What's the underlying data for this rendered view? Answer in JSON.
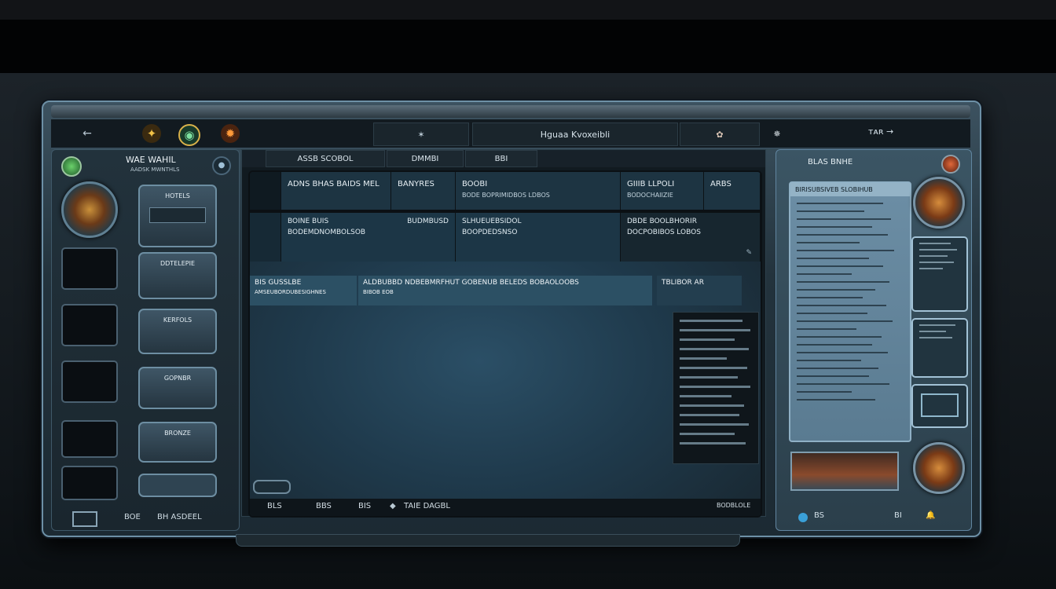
{
  "window": {
    "title": ""
  },
  "toolbar": {
    "center_label": "Hguaa Kvoxeibli",
    "right_label": "ᴛᴀʀ →",
    "right_icon_label": "🔔"
  },
  "left_panel": {
    "title": "WAE WAHIL",
    "subtitle": "AADSK MWNTHLS",
    "cards": [
      "HOTELS",
      "DDTELEPIE",
      "KERFOLS",
      "GOPNBR",
      "BRONZE"
    ],
    "footer_left": "BOE",
    "footer_right": "BH ASDEEL"
  },
  "breadcrumbs": [
    "ASSB SCOBOL",
    "DMMBI",
    "BBI"
  ],
  "columns": [
    {
      "title": "ADNS BHAS BAIDS MEL",
      "sub": ""
    },
    {
      "title": "BANYRES",
      "sub": ""
    },
    {
      "title": "BOOBI",
      "sub": "BODE  BOPRIMIDBOS LDBOS"
    },
    {
      "title": "GIIIB LLPOLI",
      "sub": "BODOCHAIIZIE"
    },
    {
      "title": "ARBS",
      "sub": ""
    }
  ],
  "rows": [
    {
      "title": "BOINE BUIS",
      "line": "BODEMDNOMBOLSOB",
      "right": "BUDMBUSD"
    },
    {
      "title": "SLHUEUEBSIDOL",
      "line": "BOOPDEDSNSO",
      "right": ""
    },
    {
      "title": "DBDE BOOLBHORIR",
      "line": "DOCPOBIBOS LOBOS",
      "right": ""
    }
  ],
  "banner": {
    "seg1": "BIS  GUSSLBE",
    "seg1_sub": "AMSEUBORDUBESIGHNES",
    "seg2": "ALDBUBBD NDBEBMRFHUT   GOBENUB  BELEDS BOBAOLOOBS",
    "seg2_sub": "BIBOB  EOB",
    "seg3": "TBLIBOR AR"
  },
  "vp_footer": {
    "a": "BLS",
    "b": "BBS",
    "c": "BIS",
    "d": "TAIE DAGBL",
    "e": "BODBLOLE"
  },
  "right_panel": {
    "title": "BLAS  BNHE",
    "sheet_head": "BIRISUBSIVEB SLOBIHUB",
    "footer_left": "BS",
    "footer_right": "BI"
  },
  "icons": {
    "toolbar_back": "back-arrow-icon",
    "toolbar_emblem_1": "gold-crest-icon",
    "toolbar_emblem_2": "eye-orb-icon",
    "toolbar_emblem_3": "fire-crest-icon",
    "toolbar_star": "star-icon",
    "toolbar_flower": "flower-icon"
  },
  "colors": {
    "frame_border": "#6d90a6",
    "accent_orange": "#c8782e",
    "panel_blue": "#2b4f66"
  }
}
